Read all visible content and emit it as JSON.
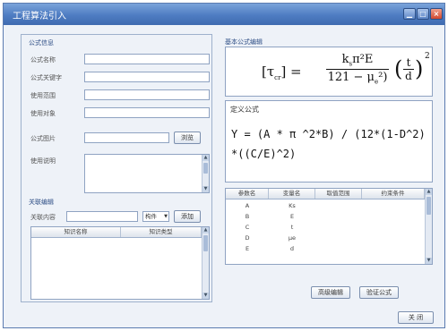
{
  "window": {
    "title": "工程算法引入",
    "min_icon": "minimize-icon",
    "max_icon": "maximize-icon",
    "close_icon": "close-icon",
    "close_glyph": "×"
  },
  "left": {
    "formula_section": "公式信息",
    "fields": [
      {
        "label": "公式名称",
        "value": ""
      },
      {
        "label": "公式关键字",
        "value": ""
      },
      {
        "label": "使用范围",
        "value": ""
      },
      {
        "label": "使用对象",
        "value": ""
      }
    ],
    "image_label": "公式图片",
    "browse_button": "浏览",
    "desc_label": "使用说明",
    "assoc_section": "关联编辑",
    "assoc_content_label": "关联内容",
    "assoc_select": "构件",
    "add_button": "添加",
    "knowledge_table": {
      "columns": [
        "知识名称",
        "知识类型"
      ]
    }
  },
  "right": {
    "basic_section": "基本公式编辑",
    "formula_render": {
      "lhs": "[τ",
      "lhs_sub": "cr",
      "rhs_num": "k",
      "rhs_num_sub": "s",
      "rhs_num_rest": "π²E",
      "rhs_den": "121 − μ",
      "rhs_den_sub": "e",
      "rhs_den_close": "²)",
      "frac2_num": "t",
      "frac2_den": "d",
      "exponent": "2"
    },
    "define_label": "定义公式",
    "define_formula": "Y = (A * π ^2*B) / (12*(1-D^2)*((C/E)^2)",
    "param_table": {
      "columns": [
        "参数名",
        "变量名",
        "取值范围",
        "约束条件"
      ],
      "rows": [
        [
          "A",
          "Ks",
          "",
          ""
        ],
        [
          "B",
          "E",
          "",
          ""
        ],
        [
          "C",
          "t",
          "",
          ""
        ],
        [
          "D",
          "μe",
          "",
          ""
        ],
        [
          "E",
          "d",
          "",
          ""
        ]
      ]
    },
    "advanced_button": "高级编辑",
    "verify_button": "验证公式"
  },
  "footer": {
    "close_button": "关 闭"
  }
}
